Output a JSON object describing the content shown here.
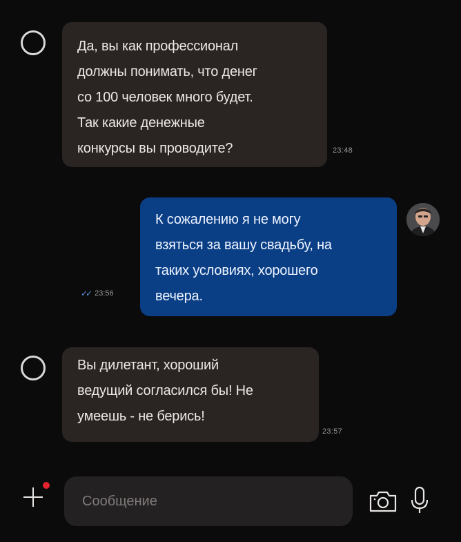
{
  "messages": [
    {
      "direction": "incoming",
      "text": "Да, вы как профессионал\nдолжны понимать, что денег\nсо 100 человек много будет.\nТак какие денежные\nконкурсы вы проводите?",
      "time": "23:48"
    },
    {
      "direction": "outgoing",
      "text": "К сожалению я не могу\nвзяться за вашу свадьбу, на\nтаких условиях, хорошего\nвечера.",
      "time": "23:56",
      "read_icon": "double-check-icon"
    },
    {
      "direction": "incoming",
      "text": "Вы дилетант, хороший\nведущий согласился бы! Не\nумеешь - не берись!",
      "time": "23:57"
    }
  ],
  "composer": {
    "placeholder": "Сообщение",
    "value": "",
    "icons": [
      "plus-icon",
      "camera-icon",
      "microphone-icon"
    ]
  },
  "colors": {
    "background": "#0b0b0c",
    "incoming_bubble": "#2a2523",
    "outgoing_bubble": "#0a3f86",
    "read_ticks": "#5b8fdc",
    "notification_dot": "#e5232f"
  }
}
